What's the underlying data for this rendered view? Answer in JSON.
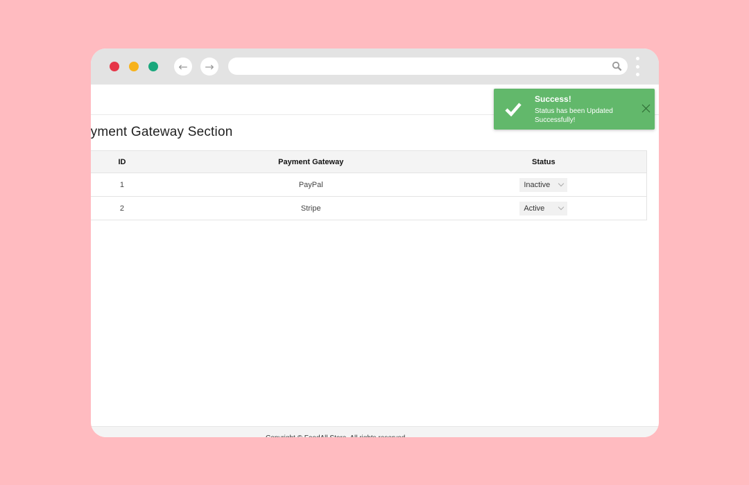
{
  "browser": {
    "back_icon": "arrow-left",
    "forward_icon": "arrow-right",
    "address_value": "",
    "search_icon": "magnifier",
    "menu_icon": "vertical-dots"
  },
  "page": {
    "title": "Payment Gateway Section",
    "table": {
      "headers": [
        "ID",
        "Payment Gateway",
        "Status"
      ],
      "rows": [
        {
          "id": "1",
          "gateway": "PayPal",
          "status": "Inactive"
        },
        {
          "id": "2",
          "gateway": "Stripe",
          "status": "Active"
        }
      ]
    },
    "footer": "Copyright © FoodAll Store. All rights reserved."
  },
  "toast": {
    "title": "Success!",
    "message": "Status has been Updated Successfully!",
    "color": "#62b86b"
  }
}
